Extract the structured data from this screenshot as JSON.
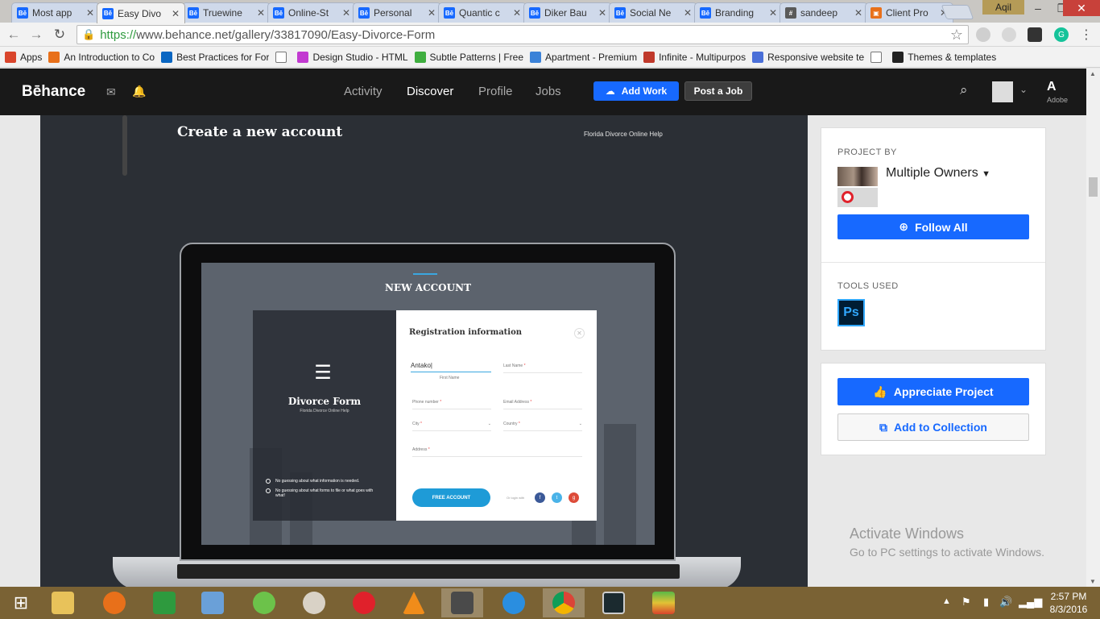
{
  "tabs": [
    {
      "label": "Most app",
      "icon": "Bē"
    },
    {
      "label": "Easy Divo",
      "icon": "Bē",
      "active": true
    },
    {
      "label": "Truewine",
      "icon": "Bē"
    },
    {
      "label": "Online-St",
      "icon": "Bē"
    },
    {
      "label": "Personal",
      "icon": "Bē"
    },
    {
      "label": "Quantic c",
      "icon": "Bē"
    },
    {
      "label": "Diker Bau",
      "icon": "Bē"
    },
    {
      "label": "Social Ne",
      "icon": "Bē"
    },
    {
      "label": "Branding",
      "icon": "Bē"
    },
    {
      "label": "sandeep",
      "icon": "#"
    },
    {
      "label": "Client Pro",
      "icon": "▣"
    }
  ],
  "window": {
    "user": "Aqil"
  },
  "address": {
    "scheme": "https://",
    "rest": "www.behance.net/gallery/33817090/Easy-Divorce-Form"
  },
  "bookmarks": [
    {
      "label": "Apps",
      "icon": "apps-grid-icon",
      "color": "#d9452c"
    },
    {
      "label": "An Introduction to Co",
      "icon": "plus-icon",
      "color": "#e8701a"
    },
    {
      "label": "Best Practices for For",
      "icon": "linkedin-icon",
      "color": "#0a66c2"
    },
    {
      "label": "",
      "icon": "page-icon",
      "color": "#ffffff"
    },
    {
      "label": "Design Studio - HTML",
      "icon": "d-icon",
      "color": "#c23ad1"
    },
    {
      "label": "Subtle Patterns | Free",
      "icon": "zigzag-icon",
      "color": "#3fae3f"
    },
    {
      "label": "Apartment - Premium",
      "icon": "house-icon",
      "color": "#3b82d8"
    },
    {
      "label": "Infinite - Multipurpos",
      "icon": "wp-icon",
      "color": "#c0392b"
    },
    {
      "label": "Responsive website te",
      "icon": "shield-icon",
      "color": "#4a6fd8"
    },
    {
      "label": "",
      "icon": "page-icon",
      "color": "#ffffff"
    },
    {
      "label": "Themes & templates",
      "icon": "w-icon",
      "color": "#222222"
    }
  ],
  "behance": {
    "logo": "Bēhance",
    "nav": [
      "Activity",
      "Discover",
      "Profile",
      "Jobs"
    ],
    "add_work": "Add Work",
    "post_job": "Post a Job",
    "adobe": "Adobe"
  },
  "project": {
    "heading": "Create a new account",
    "subheading": "Florida Divorce Online Help",
    "screen": {
      "title": "NEW ACCOUNT",
      "brand": "Divorce Form",
      "brand_sub": "Florida Divorce Online Help",
      "bullets": [
        "No guessing about what information is needed.",
        "No guessing about what forms to file or what goes with what!"
      ],
      "form_title": "Registration information",
      "first_name_value": "Antako|",
      "first_name_caption": "First Name",
      "fields": {
        "last_name": "Last Name",
        "phone": "Phone number",
        "email": "Email Address",
        "city": "City",
        "country": "Country",
        "address": "Address"
      },
      "button": "FREE ACCOUNT",
      "or_login": "Or login with"
    }
  },
  "sidebar": {
    "project_by": "PROJECT BY",
    "owners": "Multiple Owners",
    "follow": "Follow All",
    "tools_used": "TOOLS USED",
    "tool": "Ps",
    "appreciate": "Appreciate Project",
    "add_collection": "Add to Collection"
  },
  "watermark": {
    "line1": "Activate Windows",
    "line2": "Go to PC settings to activate Windows."
  },
  "clock": {
    "time": "2:57 PM",
    "date": "8/3/2016"
  },
  "colors": {
    "accent": "#1769ff",
    "nav_bg": "#191919",
    "taskbar": "#7a6234"
  }
}
